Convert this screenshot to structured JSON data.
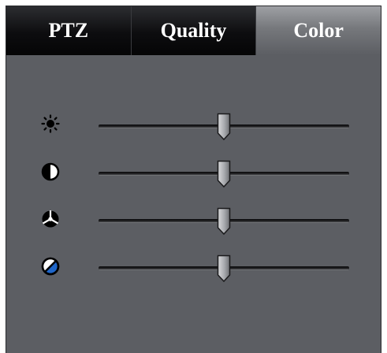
{
  "tabs": [
    {
      "label": "PTZ",
      "active": false
    },
    {
      "label": "Quality",
      "active": false
    },
    {
      "label": "Color",
      "active": true
    }
  ],
  "sliders": [
    {
      "name": "brightness",
      "icon": "brightness-icon",
      "value": 0.5
    },
    {
      "name": "contrast",
      "icon": "contrast-icon",
      "value": 0.5
    },
    {
      "name": "saturation",
      "icon": "saturation-icon",
      "value": 0.5
    },
    {
      "name": "hue",
      "icon": "hue-icon",
      "value": 0.5
    }
  ],
  "colors": {
    "panel": "#5c5e63",
    "tab_inactive": "#0d0d0f",
    "tab_active": "#8a8c90",
    "hue_accent": "#1f66c9"
  }
}
